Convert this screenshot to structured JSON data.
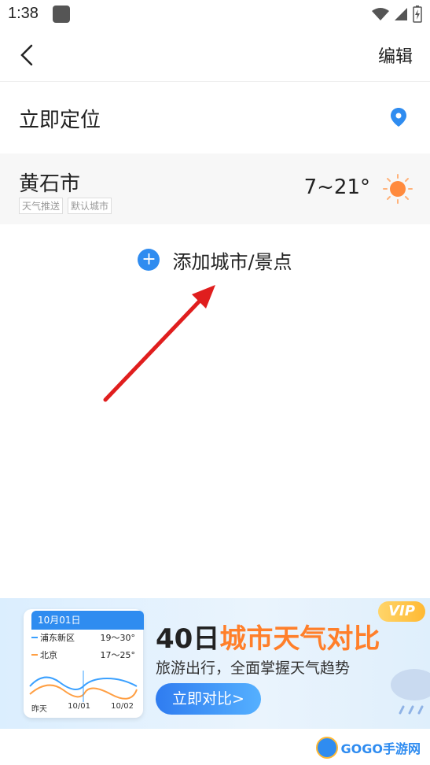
{
  "status_bar": {
    "time": "1:38"
  },
  "titlebar": {
    "edit_label": "编辑"
  },
  "locate": {
    "label": "立即定位"
  },
  "city": {
    "name": "黄石市",
    "tags": [
      "天气推送",
      "默认城市"
    ],
    "temp": "7~21°"
  },
  "add_city": {
    "label": "添加城市/景点"
  },
  "banner": {
    "headline_num": "40日",
    "headline_hi": "城市天气对比",
    "subtext": "旅游出行，全面掌握天气趋势",
    "cta": "立即对比>",
    "vip": "VIP",
    "card": {
      "date": "10月01日",
      "rows": [
        {
          "city": "浦东新区",
          "temp": "19～30°",
          "color": "#3aa0ff"
        },
        {
          "city": "北京",
          "temp": "17～25°",
          "color": "#ff9f43"
        }
      ],
      "xlabels": [
        "昨天",
        "10/01",
        "10/02"
      ]
    }
  },
  "watermark": {
    "text": "GOGO手游网"
  },
  "colors": {
    "accent": "#2f8cf0",
    "arrow": "#e01e1e",
    "highlight": "#ff7f2a"
  }
}
